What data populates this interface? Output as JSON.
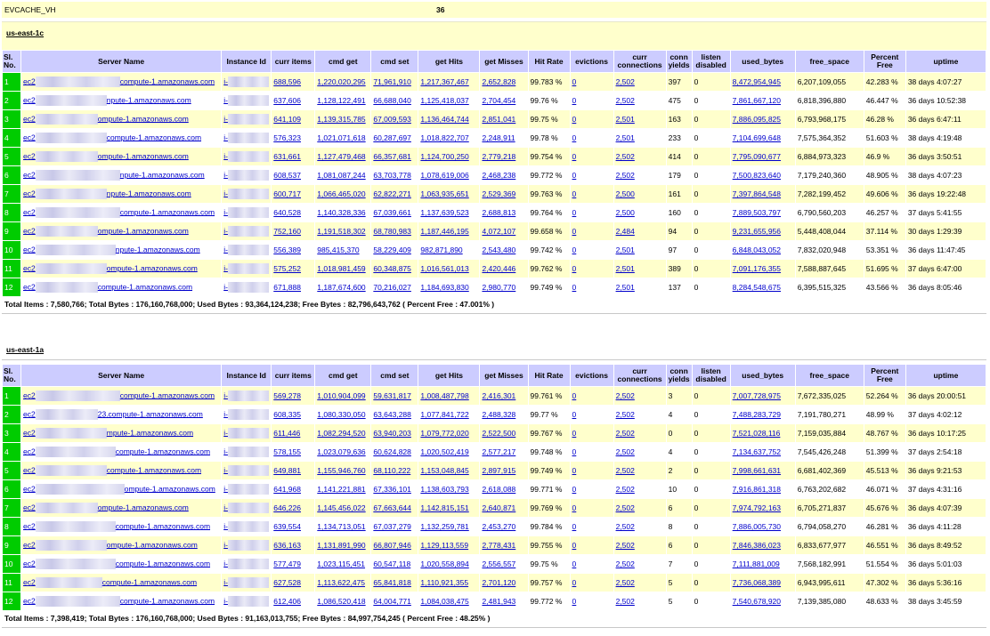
{
  "app": {
    "cache_name": "EVCACHE_VH",
    "server_count": "36"
  },
  "columns": [
    "Sl. No.",
    "Server Name",
    "Instance Id",
    "curr items",
    "cmd get",
    "cmd set",
    "get Hits",
    "get Misses",
    "Hit Rate",
    "evictions",
    "curr connections",
    "conn yields",
    "listen disabled",
    "used_bytes",
    "free_space",
    "Percent Free",
    "uptime"
  ],
  "regions": [
    {
      "name": "us-east-1c",
      "rows": [
        {
          "sl": "1",
          "prefix": "ec2",
          "suffix": "compute-1.amazonaws.com",
          "inst": "i-",
          "curr_items": "688,596",
          "cmd_get": "1,220,020,295",
          "cmd_set": "71,961,910",
          "get_hits": "1,217,367,467",
          "get_misses": "2,652,828",
          "hit_rate": "99.783 %",
          "evictions": "0",
          "curr_conn": "2,502",
          "conn_yields": "397",
          "listen_disabled": "0",
          "used_bytes": "8,472,954,945",
          "free_space": "6,207,109,055",
          "pct_free": "42.283 %",
          "uptime": "38 days 4:07:27"
        },
        {
          "sl": "2",
          "prefix": "ec2",
          "suffix": "npute-1.amazonaws.com",
          "inst": "i-",
          "curr_items": "637,606",
          "cmd_get": "1,128,122,491",
          "cmd_set": "66,688,040",
          "get_hits": "1,125,418,037",
          "get_misses": "2,704,454",
          "hit_rate": "99.76 %",
          "evictions": "0",
          "curr_conn": "2,502",
          "conn_yields": "475",
          "listen_disabled": "0",
          "used_bytes": "7,861,667,120",
          "free_space": "6,818,396,880",
          "pct_free": "46.447 %",
          "uptime": "36 days 10:52:38"
        },
        {
          "sl": "3",
          "prefix": "ec2",
          "suffix": "ompute-1.amazonaws.com",
          "inst": "i-",
          "curr_items": "641,109",
          "cmd_get": "1,139,315,785",
          "cmd_set": "67,009,593",
          "get_hits": "1,136,464,744",
          "get_misses": "2,851,041",
          "hit_rate": "99.75 %",
          "evictions": "0",
          "curr_conn": "2,501",
          "conn_yields": "163",
          "listen_disabled": "0",
          "used_bytes": "7,886,095,825",
          "free_space": "6,793,968,175",
          "pct_free": "46.28 %",
          "uptime": "36 days 6:47:11"
        },
        {
          "sl": "4",
          "prefix": "ec2",
          "suffix": "compute-1.amazonaws.com",
          "inst": "i-",
          "curr_items": "576,323",
          "cmd_get": "1,021,071,618",
          "cmd_set": "60,287,697",
          "get_hits": "1,018,822,707",
          "get_misses": "2,248,911",
          "hit_rate": "99.78 %",
          "evictions": "0",
          "curr_conn": "2,501",
          "conn_yields": "233",
          "listen_disabled": "0",
          "used_bytes": "7,104,699,648",
          "free_space": "7,575,364,352",
          "pct_free": "51.603 %",
          "uptime": "38 days 4:19:48"
        },
        {
          "sl": "5",
          "prefix": "ec2",
          "suffix": "ompute-1.amazonaws.com",
          "inst": "i-",
          "curr_items": "631,661",
          "cmd_get": "1,127,479,468",
          "cmd_set": "66,357,681",
          "get_hits": "1,124,700,250",
          "get_misses": "2,779,218",
          "hit_rate": "99.754 %",
          "evictions": "0",
          "curr_conn": "2,502",
          "conn_yields": "414",
          "listen_disabled": "0",
          "used_bytes": "7,795,090,677",
          "free_space": "6,884,973,323",
          "pct_free": "46.9 %",
          "uptime": "36 days 3:50:51"
        },
        {
          "sl": "6",
          "prefix": "ec2",
          "suffix": "npute-1.amazonaws.com",
          "inst": "i-",
          "curr_items": "608,537",
          "cmd_get": "1,081,087,244",
          "cmd_set": "63,703,778",
          "get_hits": "1,078,619,006",
          "get_misses": "2,468,238",
          "hit_rate": "99.772 %",
          "evictions": "0",
          "curr_conn": "2,502",
          "conn_yields": "179",
          "listen_disabled": "0",
          "used_bytes": "7,500,823,640",
          "free_space": "7,179,240,360",
          "pct_free": "48.905 %",
          "uptime": "38 days 4:07:23"
        },
        {
          "sl": "7",
          "prefix": "ec2",
          "suffix": "npute-1.amazonaws.com",
          "inst": "i-",
          "curr_items": "600,717",
          "cmd_get": "1,066,465,020",
          "cmd_set": "62,822,271",
          "get_hits": "1,063,935,651",
          "get_misses": "2,529,369",
          "hit_rate": "99.763 %",
          "evictions": "0",
          "curr_conn": "2,500",
          "conn_yields": "161",
          "listen_disabled": "0",
          "used_bytes": "7,397,864,548",
          "free_space": "7,282,199,452",
          "pct_free": "49.606 %",
          "uptime": "36 days 19:22:48"
        },
        {
          "sl": "8",
          "prefix": "ec2",
          "suffix": "compute-1.amazonaws.com",
          "inst": "i-",
          "curr_items": "640,528",
          "cmd_get": "1,140,328,336",
          "cmd_set": "67,039,661",
          "get_hits": "1,137,639,523",
          "get_misses": "2,688,813",
          "hit_rate": "99.764 %",
          "evictions": "0",
          "curr_conn": "2,500",
          "conn_yields": "160",
          "listen_disabled": "0",
          "used_bytes": "7,889,503,797",
          "free_space": "6,790,560,203",
          "pct_free": "46.257 %",
          "uptime": "37 days 5:41:55"
        },
        {
          "sl": "9",
          "prefix": "ec2",
          "suffix": "ompute-1.amazonaws.com",
          "inst": "i-",
          "curr_items": "752,160",
          "cmd_get": "1,191,518,302",
          "cmd_set": "68,780,983",
          "get_hits": "1,187,446,195",
          "get_misses": "4,072,107",
          "hit_rate": "99.658 %",
          "evictions": "0",
          "curr_conn": "2,484",
          "conn_yields": "94",
          "listen_disabled": "0",
          "used_bytes": "9,231,655,956",
          "free_space": "5,448,408,044",
          "pct_free": "37.114 %",
          "uptime": "30 days 1:29:39"
        },
        {
          "sl": "10",
          "prefix": "ec2",
          "suffix": "npute-1.amazonaws.com",
          "inst": "i-",
          "curr_items": "556,389",
          "cmd_get": "985,415,370",
          "cmd_set": "58,229,409",
          "get_hits": "982,871,890",
          "get_misses": "2,543,480",
          "hit_rate": "99.742 %",
          "evictions": "0",
          "curr_conn": "2,501",
          "conn_yields": "97",
          "listen_disabled": "0",
          "used_bytes": "6,848,043,052",
          "free_space": "7,832,020,948",
          "pct_free": "53.351 %",
          "uptime": "36 days 11:47:45"
        },
        {
          "sl": "11",
          "prefix": "ec2",
          "suffix": "ompute-1.amazonaws.com",
          "inst": "i-",
          "curr_items": "575,252",
          "cmd_get": "1,018,981,459",
          "cmd_set": "60,348,875",
          "get_hits": "1,016,561,013",
          "get_misses": "2,420,446",
          "hit_rate": "99.762 %",
          "evictions": "0",
          "curr_conn": "2,501",
          "conn_yields": "389",
          "listen_disabled": "0",
          "used_bytes": "7,091,176,355",
          "free_space": "7,588,887,645",
          "pct_free": "51.695 %",
          "uptime": "37 days 6:47:00"
        },
        {
          "sl": "12",
          "prefix": "ec2",
          "suffix": "compute-1.amazonaws.com",
          "inst": "i-",
          "curr_items": "671,888",
          "cmd_get": "1,187,674,600",
          "cmd_set": "70,216,027",
          "get_hits": "1,184,693,830",
          "get_misses": "2,980,770",
          "hit_rate": "99.749 %",
          "evictions": "0",
          "curr_conn": "2,501",
          "conn_yields": "137",
          "listen_disabled": "0",
          "used_bytes": "8,284,548,675",
          "free_space": "6,395,515,325",
          "pct_free": "43.566 %",
          "uptime": "36 days 8:05:46"
        }
      ],
      "total": "Total Items : 7,580,766; Total Bytes : 176,160,768,000; Used Bytes : 93,364,124,238; Free Bytes : 82,796,643,762 ( Percent Free : 47.001% )"
    },
    {
      "name": "us-east-1a",
      "rows": [
        {
          "sl": "1",
          "prefix": "ec2",
          "suffix": "compute-1.amazonaws.com",
          "inst": "i-",
          "curr_items": "569,278",
          "cmd_get": "1,010,904,099",
          "cmd_set": "59,631,817",
          "get_hits": "1,008,487,798",
          "get_misses": "2,416,301",
          "hit_rate": "99.761 %",
          "evictions": "0",
          "curr_conn": "2,502",
          "conn_yields": "3",
          "listen_disabled": "0",
          "used_bytes": "7,007,728,975",
          "free_space": "7,672,335,025",
          "pct_free": "52.264 %",
          "uptime": "36 days 20:00:51"
        },
        {
          "sl": "2",
          "prefix": "ec2",
          "suffix": "23.compute-1.amazonaws.com",
          "inst": "i-",
          "curr_items": "608,335",
          "cmd_get": "1,080,330,050",
          "cmd_set": "63,643,288",
          "get_hits": "1,077,841,722",
          "get_misses": "2,488,328",
          "hit_rate": "99.77 %",
          "evictions": "0",
          "curr_conn": "2,502",
          "conn_yields": "4",
          "listen_disabled": "0",
          "used_bytes": "7,488,283,729",
          "free_space": "7,191,780,271",
          "pct_free": "48.99 %",
          "uptime": "37 days 4:02:12"
        },
        {
          "sl": "3",
          "prefix": "ec2",
          "suffix": "mpute-1.amazonaws.com",
          "inst": "i-",
          "curr_items": "611,446",
          "cmd_get": "1,082,294,520",
          "cmd_set": "63,940,203",
          "get_hits": "1,079,772,020",
          "get_misses": "2,522,500",
          "hit_rate": "99.767 %",
          "evictions": "0",
          "curr_conn": "2,502",
          "conn_yields": "0",
          "listen_disabled": "0",
          "used_bytes": "7,521,028,116",
          "free_space": "7,159,035,884",
          "pct_free": "48.767 %",
          "uptime": "36 days 10:17:25"
        },
        {
          "sl": "4",
          "prefix": "ec2",
          "suffix": "compute-1.amazonaws.com",
          "inst": "i-",
          "curr_items": "578,155",
          "cmd_get": "1,023,079,636",
          "cmd_set": "60,624,828",
          "get_hits": "1,020,502,419",
          "get_misses": "2,577,217",
          "hit_rate": "99.748 %",
          "evictions": "0",
          "curr_conn": "2,502",
          "conn_yields": "4",
          "listen_disabled": "0",
          "used_bytes": "7,134,637,752",
          "free_space": "7,545,426,248",
          "pct_free": "51.399 %",
          "uptime": "37 days 2:54:18"
        },
        {
          "sl": "5",
          "prefix": "ec2",
          "suffix": "compute-1.amazonaws.com",
          "inst": "i-",
          "curr_items": "649,881",
          "cmd_get": "1,155,946,760",
          "cmd_set": "68,110,222",
          "get_hits": "1,153,048,845",
          "get_misses": "2,897,915",
          "hit_rate": "99.749 %",
          "evictions": "0",
          "curr_conn": "2,502",
          "conn_yields": "2",
          "listen_disabled": "0",
          "used_bytes": "7,998,661,631",
          "free_space": "6,681,402,369",
          "pct_free": "45.513 %",
          "uptime": "36 days 9:21:53"
        },
        {
          "sl": "6",
          "prefix": "ec2",
          "suffix": "ompute-1.amazonaws.com",
          "inst": "i-",
          "curr_items": "641,968",
          "cmd_get": "1,141,221,881",
          "cmd_set": "67,336,101",
          "get_hits": "1,138,603,793",
          "get_misses": "2,618,088",
          "hit_rate": "99.771 %",
          "evictions": "0",
          "curr_conn": "2,502",
          "conn_yields": "10",
          "listen_disabled": "0",
          "used_bytes": "7,916,861,318",
          "free_space": "6,763,202,682",
          "pct_free": "46.071 %",
          "uptime": "37 days 4:31:16"
        },
        {
          "sl": "7",
          "prefix": "ec2",
          "suffix": "ompute-1.amazonaws.com",
          "inst": "i-",
          "curr_items": "646,226",
          "cmd_get": "1,145,456,022",
          "cmd_set": "67,663,644",
          "get_hits": "1,142,815,151",
          "get_misses": "2,640,871",
          "hit_rate": "99.769 %",
          "evictions": "0",
          "curr_conn": "2,502",
          "conn_yields": "6",
          "listen_disabled": "0",
          "used_bytes": "7,974,792,163",
          "free_space": "6,705,271,837",
          "pct_free": "45.676 %",
          "uptime": "36 days 4:07:39"
        },
        {
          "sl": "8",
          "prefix": "ec2",
          "suffix": "compute-1.amazonaws.com",
          "inst": "i-",
          "curr_items": "639,554",
          "cmd_get": "1,134,713,051",
          "cmd_set": "67,037,279",
          "get_hits": "1,132,259,781",
          "get_misses": "2,453,270",
          "hit_rate": "99.784 %",
          "evictions": "0",
          "curr_conn": "2,502",
          "conn_yields": "8",
          "listen_disabled": "0",
          "used_bytes": "7,886,005,730",
          "free_space": "6,794,058,270",
          "pct_free": "46.281 %",
          "uptime": "36 days 4:11:28"
        },
        {
          "sl": "9",
          "prefix": "ec2",
          "suffix": "ompute-1.amazonaws.com",
          "inst": "i-",
          "curr_items": "636,163",
          "cmd_get": "1,131,891,990",
          "cmd_set": "66,807,946",
          "get_hits": "1,129,113,559",
          "get_misses": "2,778,431",
          "hit_rate": "99.755 %",
          "evictions": "0",
          "curr_conn": "2,502",
          "conn_yields": "6",
          "listen_disabled": "0",
          "used_bytes": "7,846,386,023",
          "free_space": "6,833,677,977",
          "pct_free": "46.551 %",
          "uptime": "36 days 8:49:52"
        },
        {
          "sl": "10",
          "prefix": "ec2",
          "suffix": "compute-1.amazonaws.com",
          "inst": "i-",
          "curr_items": "577,479",
          "cmd_get": "1,023,115,451",
          "cmd_set": "60,547,118",
          "get_hits": "1,020,558,894",
          "get_misses": "2,556,557",
          "hit_rate": "99.75 %",
          "evictions": "0",
          "curr_conn": "2,502",
          "conn_yields": "7",
          "listen_disabled": "0",
          "used_bytes": "7,111,881,009",
          "free_space": "7,568,182,991",
          "pct_free": "51.554 %",
          "uptime": "36 days 5:01:03"
        },
        {
          "sl": "11",
          "prefix": "ec2",
          "suffix": "compute-1.amazonaws.com",
          "inst": "i-",
          "curr_items": "627,528",
          "cmd_get": "1,113,622,475",
          "cmd_set": "65,841,818",
          "get_hits": "1,110,921,355",
          "get_misses": "2,701,120",
          "hit_rate": "99.757 %",
          "evictions": "0",
          "curr_conn": "2,502",
          "conn_yields": "5",
          "listen_disabled": "0",
          "used_bytes": "7,736,068,389",
          "free_space": "6,943,995,611",
          "pct_free": "47.302 %",
          "uptime": "36 days 5:36:16"
        },
        {
          "sl": "12",
          "prefix": "ec2",
          "suffix": "compute-1.amazonaws.com",
          "inst": "i-",
          "curr_items": "612,406",
          "cmd_get": "1,086,520,418",
          "cmd_set": "64,004,771",
          "get_hits": "1,084,038,475",
          "get_misses": "2,481,943",
          "hit_rate": "99.772 %",
          "evictions": "0",
          "curr_conn": "2,502",
          "conn_yields": "5",
          "listen_disabled": "0",
          "used_bytes": "7,540,678,920",
          "free_space": "7,139,385,080",
          "pct_free": "48.633 %",
          "uptime": "38 days 3:45:59"
        }
      ],
      "total": "Total Items : 7,398,419; Total Bytes : 176,160,768,000; Used Bytes : 91,163,013,755; Free Bytes : 84,997,754,245 ( Percent Free : 48.25% )"
    }
  ]
}
